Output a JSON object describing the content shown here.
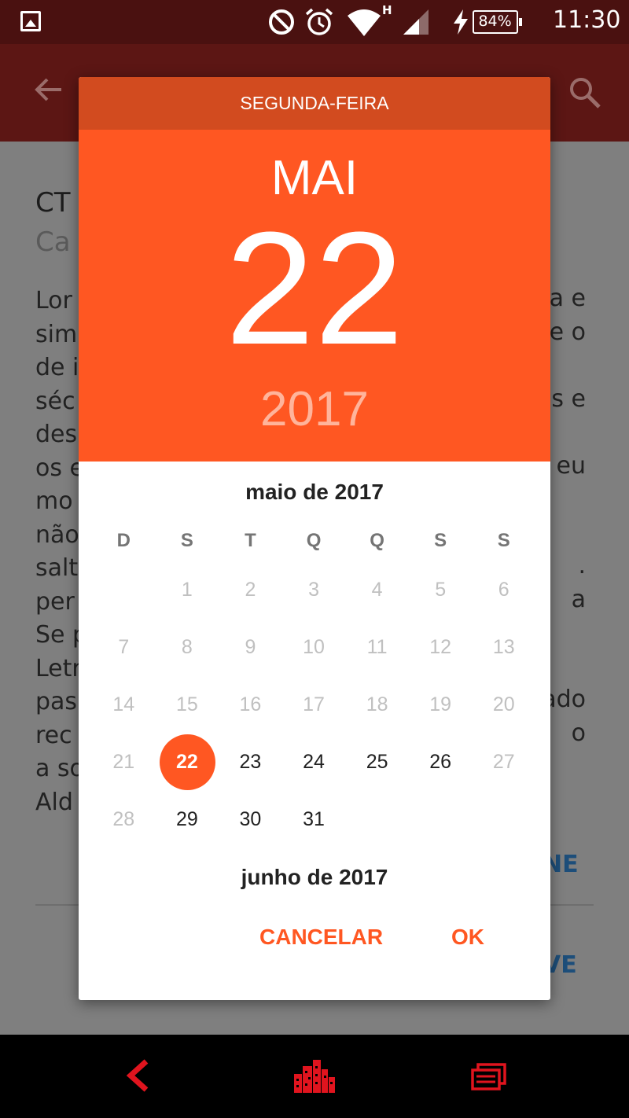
{
  "status_bar": {
    "battery": "84%",
    "time": "11:30",
    "network_type": "H",
    "icons": [
      "gallery-icon",
      "do-not-disturb-icon",
      "alarm-icon",
      "wifi-icon",
      "signal-icon",
      "charging-icon",
      "battery-icon"
    ]
  },
  "background": {
    "title": "CT",
    "subtitle": "Ca",
    "text_left": "Lor\nsim\nde i\nséc\ndes\nos e\nmo\nnão\nsalt\nper\nSe p\nLetr\npas\nrec\na so\nAld",
    "text_right": [
      "a e",
      "e o",
      "",
      "s e",
      "",
      "eu",
      "",
      "",
      ".",
      "a",
      "",
      "",
      "ado",
      "o"
    ],
    "link_1": "NE",
    "link_2": "VE"
  },
  "dialog": {
    "weekday": "SEGUNDA-FEIRA",
    "month": "MAI",
    "day": "22",
    "year": "2017",
    "current_month_label": "maio de 2017",
    "next_month_label": "junho de 2017",
    "weekday_headers": [
      "D",
      "S",
      "T",
      "Q",
      "Q",
      "S",
      "S"
    ],
    "weeks": [
      [
        {
          "d": "",
          "s": "empty"
        },
        {
          "d": "1",
          "s": "disabled"
        },
        {
          "d": "2",
          "s": "disabled"
        },
        {
          "d": "3",
          "s": "disabled"
        },
        {
          "d": "4",
          "s": "disabled"
        },
        {
          "d": "5",
          "s": "disabled"
        },
        {
          "d": "6",
          "s": "disabled"
        }
      ],
      [
        {
          "d": "7",
          "s": "disabled"
        },
        {
          "d": "8",
          "s": "disabled"
        },
        {
          "d": "9",
          "s": "disabled"
        },
        {
          "d": "10",
          "s": "disabled"
        },
        {
          "d": "11",
          "s": "disabled"
        },
        {
          "d": "12",
          "s": "disabled"
        },
        {
          "d": "13",
          "s": "disabled"
        }
      ],
      [
        {
          "d": "14",
          "s": "disabled"
        },
        {
          "d": "15",
          "s": "disabled"
        },
        {
          "d": "16",
          "s": "disabled"
        },
        {
          "d": "17",
          "s": "disabled"
        },
        {
          "d": "18",
          "s": "disabled"
        },
        {
          "d": "19",
          "s": "disabled"
        },
        {
          "d": "20",
          "s": "disabled"
        }
      ],
      [
        {
          "d": "21",
          "s": "disabled"
        },
        {
          "d": "22",
          "s": "selected"
        },
        {
          "d": "23",
          "s": "enabled"
        },
        {
          "d": "24",
          "s": "enabled"
        },
        {
          "d": "25",
          "s": "enabled"
        },
        {
          "d": "26",
          "s": "enabled"
        },
        {
          "d": "27",
          "s": "disabled"
        }
      ],
      [
        {
          "d": "28",
          "s": "disabled"
        },
        {
          "d": "29",
          "s": "enabled"
        },
        {
          "d": "30",
          "s": "enabled"
        },
        {
          "d": "31",
          "s": "enabled"
        },
        {
          "d": "",
          "s": "empty"
        },
        {
          "d": "",
          "s": "empty"
        },
        {
          "d": "",
          "s": "empty"
        }
      ]
    ],
    "cancel_label": "CANCELAR",
    "ok_label": "OK"
  },
  "colors": {
    "accent": "#ff5722",
    "header_dark": "#d24b1f",
    "nav_icon": "#e0141e"
  },
  "nav_bar": {
    "icons": [
      "back-arrow-icon",
      "city-home-icon",
      "recent-apps-icon"
    ]
  }
}
